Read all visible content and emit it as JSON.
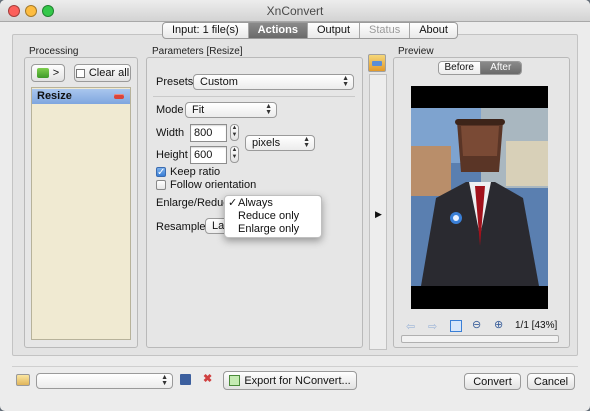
{
  "window": {
    "title": "XnConvert"
  },
  "tabs": [
    {
      "label": "Input: 1 file(s)",
      "state": "normal"
    },
    {
      "label": "Actions",
      "state": "active"
    },
    {
      "label": "Output",
      "state": "normal"
    },
    {
      "label": "Status",
      "state": "disabled"
    },
    {
      "label": "About",
      "state": "normal"
    }
  ],
  "processing": {
    "title": "Processing",
    "add_label": ">",
    "clear_label": "Clear all",
    "items": [
      "Resize"
    ]
  },
  "parameters": {
    "title": "Parameters [Resize]",
    "presets_label": "Presets",
    "presets_value": "Custom",
    "mode_label": "Mode",
    "mode_value": "Fit",
    "width_label": "Width",
    "width_value": "800",
    "height_label": "Height",
    "height_value": "600",
    "unit_value": "pixels",
    "keep_ratio_label": "Keep ratio",
    "keep_ratio_checked": true,
    "follow_orientation_label": "Follow orientation",
    "follow_orientation_checked": false,
    "enlarge_label": "Enlarge/Reduce",
    "enlarge_options": [
      "Always",
      "Reduce only",
      "Enlarge only"
    ],
    "enlarge_selected": "Always",
    "resample_label": "Resample",
    "resample_value": "Lan"
  },
  "preview": {
    "title": "Preview",
    "before_label": "Before",
    "after_label": "After",
    "page_info": "1/1 [43%]"
  },
  "footer": {
    "export_label": "Export for NConvert...",
    "convert_label": "Convert",
    "cancel_label": "Cancel"
  },
  "colors": {
    "accent": "#3a7fd6",
    "selected_item": "#8fb2e6",
    "list_bg": "#f0ead2",
    "traffic_red": "#fc605c",
    "traffic_yellow": "#fdbc40",
    "traffic_green": "#34c84a"
  }
}
